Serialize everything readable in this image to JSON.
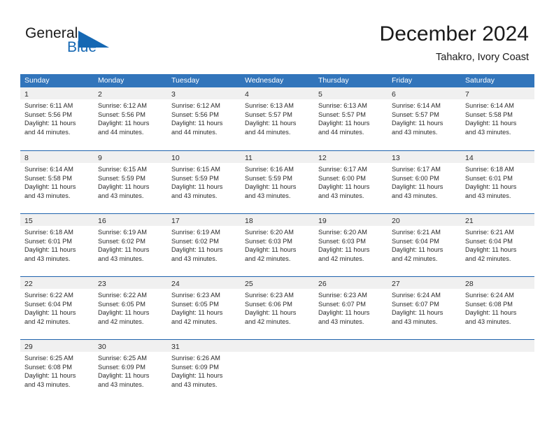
{
  "logo": {
    "word_one": "General",
    "word_two": "Blue",
    "triangle_icon": "blue-triangle-icon",
    "brand_color": "#1668b3"
  },
  "header": {
    "title": "December 2024",
    "subtitle": "Tahakro, Ivory Coast"
  },
  "theme": {
    "header_blue": "#3275bb",
    "row_divider_blue": "#1f63ad",
    "day_band_gray": "#f0f0f0"
  },
  "calendar": {
    "weekday_headers": [
      "Sunday",
      "Monday",
      "Tuesday",
      "Wednesday",
      "Thursday",
      "Friday",
      "Saturday"
    ],
    "labels": {
      "sunrise": "Sunrise:",
      "sunset": "Sunset:",
      "daylight": "Daylight:"
    },
    "weeks": [
      [
        {
          "day": "1",
          "sunrise": "Sunrise: 6:11 AM",
          "sunset": "Sunset: 5:56 PM",
          "daylight_1": "Daylight: 11 hours",
          "daylight_2": "and 44 minutes."
        },
        {
          "day": "2",
          "sunrise": "Sunrise: 6:12 AM",
          "sunset": "Sunset: 5:56 PM",
          "daylight_1": "Daylight: 11 hours",
          "daylight_2": "and 44 minutes."
        },
        {
          "day": "3",
          "sunrise": "Sunrise: 6:12 AM",
          "sunset": "Sunset: 5:56 PM",
          "daylight_1": "Daylight: 11 hours",
          "daylight_2": "and 44 minutes."
        },
        {
          "day": "4",
          "sunrise": "Sunrise: 6:13 AM",
          "sunset": "Sunset: 5:57 PM",
          "daylight_1": "Daylight: 11 hours",
          "daylight_2": "and 44 minutes."
        },
        {
          "day": "5",
          "sunrise": "Sunrise: 6:13 AM",
          "sunset": "Sunset: 5:57 PM",
          "daylight_1": "Daylight: 11 hours",
          "daylight_2": "and 44 minutes."
        },
        {
          "day": "6",
          "sunrise": "Sunrise: 6:14 AM",
          "sunset": "Sunset: 5:57 PM",
          "daylight_1": "Daylight: 11 hours",
          "daylight_2": "and 43 minutes."
        },
        {
          "day": "7",
          "sunrise": "Sunrise: 6:14 AM",
          "sunset": "Sunset: 5:58 PM",
          "daylight_1": "Daylight: 11 hours",
          "daylight_2": "and 43 minutes."
        }
      ],
      [
        {
          "day": "8",
          "sunrise": "Sunrise: 6:14 AM",
          "sunset": "Sunset: 5:58 PM",
          "daylight_1": "Daylight: 11 hours",
          "daylight_2": "and 43 minutes."
        },
        {
          "day": "9",
          "sunrise": "Sunrise: 6:15 AM",
          "sunset": "Sunset: 5:59 PM",
          "daylight_1": "Daylight: 11 hours",
          "daylight_2": "and 43 minutes."
        },
        {
          "day": "10",
          "sunrise": "Sunrise: 6:15 AM",
          "sunset": "Sunset: 5:59 PM",
          "daylight_1": "Daylight: 11 hours",
          "daylight_2": "and 43 minutes."
        },
        {
          "day": "11",
          "sunrise": "Sunrise: 6:16 AM",
          "sunset": "Sunset: 5:59 PM",
          "daylight_1": "Daylight: 11 hours",
          "daylight_2": "and 43 minutes."
        },
        {
          "day": "12",
          "sunrise": "Sunrise: 6:17 AM",
          "sunset": "Sunset: 6:00 PM",
          "daylight_1": "Daylight: 11 hours",
          "daylight_2": "and 43 minutes."
        },
        {
          "day": "13",
          "sunrise": "Sunrise: 6:17 AM",
          "sunset": "Sunset: 6:00 PM",
          "daylight_1": "Daylight: 11 hours",
          "daylight_2": "and 43 minutes."
        },
        {
          "day": "14",
          "sunrise": "Sunrise: 6:18 AM",
          "sunset": "Sunset: 6:01 PM",
          "daylight_1": "Daylight: 11 hours",
          "daylight_2": "and 43 minutes."
        }
      ],
      [
        {
          "day": "15",
          "sunrise": "Sunrise: 6:18 AM",
          "sunset": "Sunset: 6:01 PM",
          "daylight_1": "Daylight: 11 hours",
          "daylight_2": "and 43 minutes."
        },
        {
          "day": "16",
          "sunrise": "Sunrise: 6:19 AM",
          "sunset": "Sunset: 6:02 PM",
          "daylight_1": "Daylight: 11 hours",
          "daylight_2": "and 43 minutes."
        },
        {
          "day": "17",
          "sunrise": "Sunrise: 6:19 AM",
          "sunset": "Sunset: 6:02 PM",
          "daylight_1": "Daylight: 11 hours",
          "daylight_2": "and 43 minutes."
        },
        {
          "day": "18",
          "sunrise": "Sunrise: 6:20 AM",
          "sunset": "Sunset: 6:03 PM",
          "daylight_1": "Daylight: 11 hours",
          "daylight_2": "and 42 minutes."
        },
        {
          "day": "19",
          "sunrise": "Sunrise: 6:20 AM",
          "sunset": "Sunset: 6:03 PM",
          "daylight_1": "Daylight: 11 hours",
          "daylight_2": "and 42 minutes."
        },
        {
          "day": "20",
          "sunrise": "Sunrise: 6:21 AM",
          "sunset": "Sunset: 6:04 PM",
          "daylight_1": "Daylight: 11 hours",
          "daylight_2": "and 42 minutes."
        },
        {
          "day": "21",
          "sunrise": "Sunrise: 6:21 AM",
          "sunset": "Sunset: 6:04 PM",
          "daylight_1": "Daylight: 11 hours",
          "daylight_2": "and 42 minutes."
        }
      ],
      [
        {
          "day": "22",
          "sunrise": "Sunrise: 6:22 AM",
          "sunset": "Sunset: 6:04 PM",
          "daylight_1": "Daylight: 11 hours",
          "daylight_2": "and 42 minutes."
        },
        {
          "day": "23",
          "sunrise": "Sunrise: 6:22 AM",
          "sunset": "Sunset: 6:05 PM",
          "daylight_1": "Daylight: 11 hours",
          "daylight_2": "and 42 minutes."
        },
        {
          "day": "24",
          "sunrise": "Sunrise: 6:23 AM",
          "sunset": "Sunset: 6:05 PM",
          "daylight_1": "Daylight: 11 hours",
          "daylight_2": "and 42 minutes."
        },
        {
          "day": "25",
          "sunrise": "Sunrise: 6:23 AM",
          "sunset": "Sunset: 6:06 PM",
          "daylight_1": "Daylight: 11 hours",
          "daylight_2": "and 42 minutes."
        },
        {
          "day": "26",
          "sunrise": "Sunrise: 6:23 AM",
          "sunset": "Sunset: 6:07 PM",
          "daylight_1": "Daylight: 11 hours",
          "daylight_2": "and 43 minutes."
        },
        {
          "day": "27",
          "sunrise": "Sunrise: 6:24 AM",
          "sunset": "Sunset: 6:07 PM",
          "daylight_1": "Daylight: 11 hours",
          "daylight_2": "and 43 minutes."
        },
        {
          "day": "28",
          "sunrise": "Sunrise: 6:24 AM",
          "sunset": "Sunset: 6:08 PM",
          "daylight_1": "Daylight: 11 hours",
          "daylight_2": "and 43 minutes."
        }
      ],
      [
        {
          "day": "29",
          "sunrise": "Sunrise: 6:25 AM",
          "sunset": "Sunset: 6:08 PM",
          "daylight_1": "Daylight: 11 hours",
          "daylight_2": "and 43 minutes."
        },
        {
          "day": "30",
          "sunrise": "Sunrise: 6:25 AM",
          "sunset": "Sunset: 6:09 PM",
          "daylight_1": "Daylight: 11 hours",
          "daylight_2": "and 43 minutes."
        },
        {
          "day": "31",
          "sunrise": "Sunrise: 6:26 AM",
          "sunset": "Sunset: 6:09 PM",
          "daylight_1": "Daylight: 11 hours",
          "daylight_2": "and 43 minutes."
        },
        {
          "day": "",
          "sunrise": "",
          "sunset": "",
          "daylight_1": "",
          "daylight_2": ""
        },
        {
          "day": "",
          "sunrise": "",
          "sunset": "",
          "daylight_1": "",
          "daylight_2": ""
        },
        {
          "day": "",
          "sunrise": "",
          "sunset": "",
          "daylight_1": "",
          "daylight_2": ""
        },
        {
          "day": "",
          "sunrise": "",
          "sunset": "",
          "daylight_1": "",
          "daylight_2": ""
        }
      ]
    ]
  }
}
